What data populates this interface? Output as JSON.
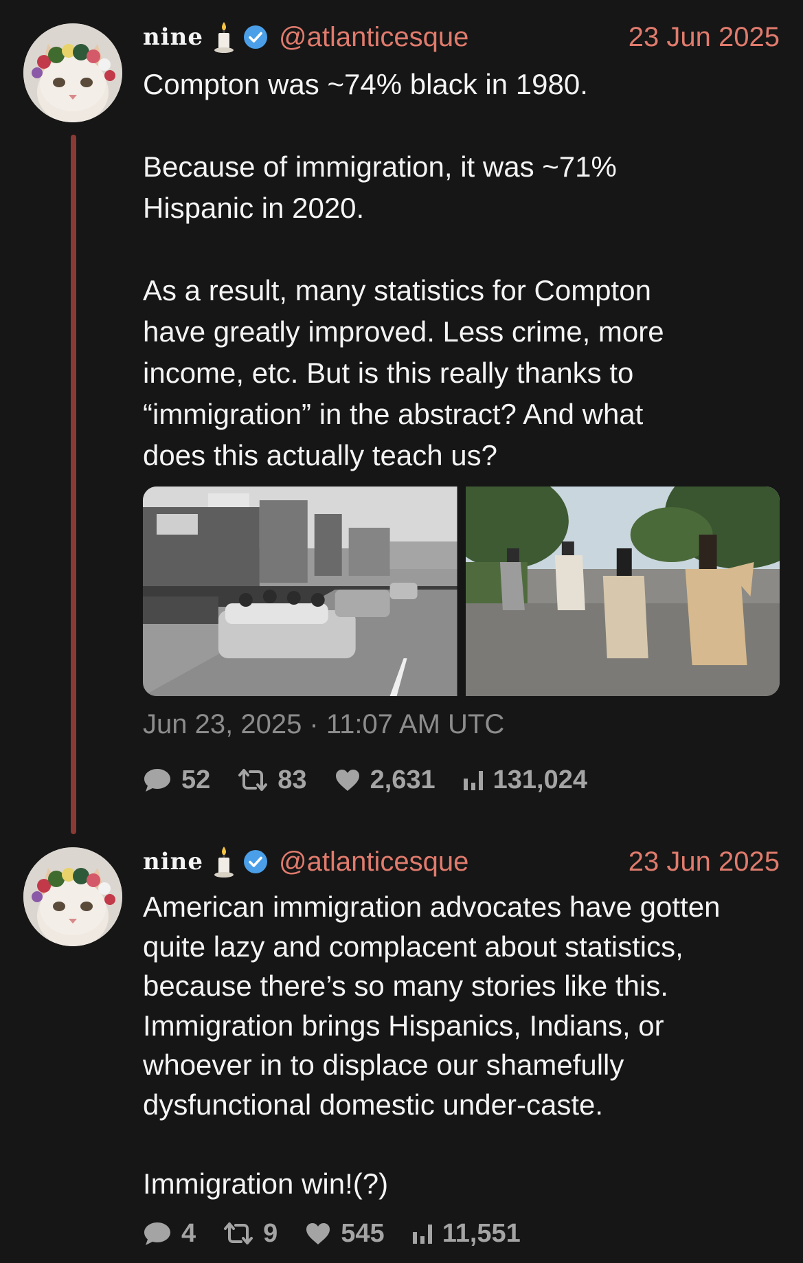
{
  "colors": {
    "background": "#161616",
    "accent": "#e07b6d",
    "thread_line": "#8a3a33",
    "muted": "#8c8c8c",
    "verified": "#4a9fe8"
  },
  "posts": [
    {
      "author": {
        "display_name": "nine",
        "badge_icon": "candle-icon",
        "verified_icon": "verified-icon",
        "handle": "@atlanticesque"
      },
      "date": "23 Jun 2025",
      "text": "Compton was ~74% black in 1980.\n\nBecause of immigration, it was ~71%\nHispanic in 2020.\n\nAs a result, many statistics for Compton\nhave greatly improved. Less crime, more\nincome, etc. But is this really thanks to\n“immigration” in the abstract? And what\ndoes this actually teach us?",
      "media": [
        {
          "kind": "photo",
          "icon": "parade-photo-icon"
        },
        {
          "kind": "photo",
          "icon": "horse-riders-photo-icon"
        }
      ],
      "timestamp": "Jun 23, 2025 · 11:07 AM UTC",
      "stats": {
        "replies": "52",
        "reposts": "83",
        "likes": "2,631",
        "views": "131,024"
      }
    },
    {
      "author": {
        "display_name": "nine",
        "badge_icon": "candle-icon",
        "verified_icon": "verified-icon",
        "handle": "@atlanticesque"
      },
      "date": "23 Jun 2025",
      "text": "American immigration advocates have gotten\nquite lazy and complacent about statistics,\nbecause there’s so many stories like this.\nImmigration brings Hispanics, Indians, or\nwhoever in to displace our shamefully\ndysfunctional domestic under-caste.\n\nImmigration win!(?)",
      "stats": {
        "replies": "4",
        "reposts": "9",
        "likes": "545",
        "views": "11,551"
      }
    }
  ]
}
